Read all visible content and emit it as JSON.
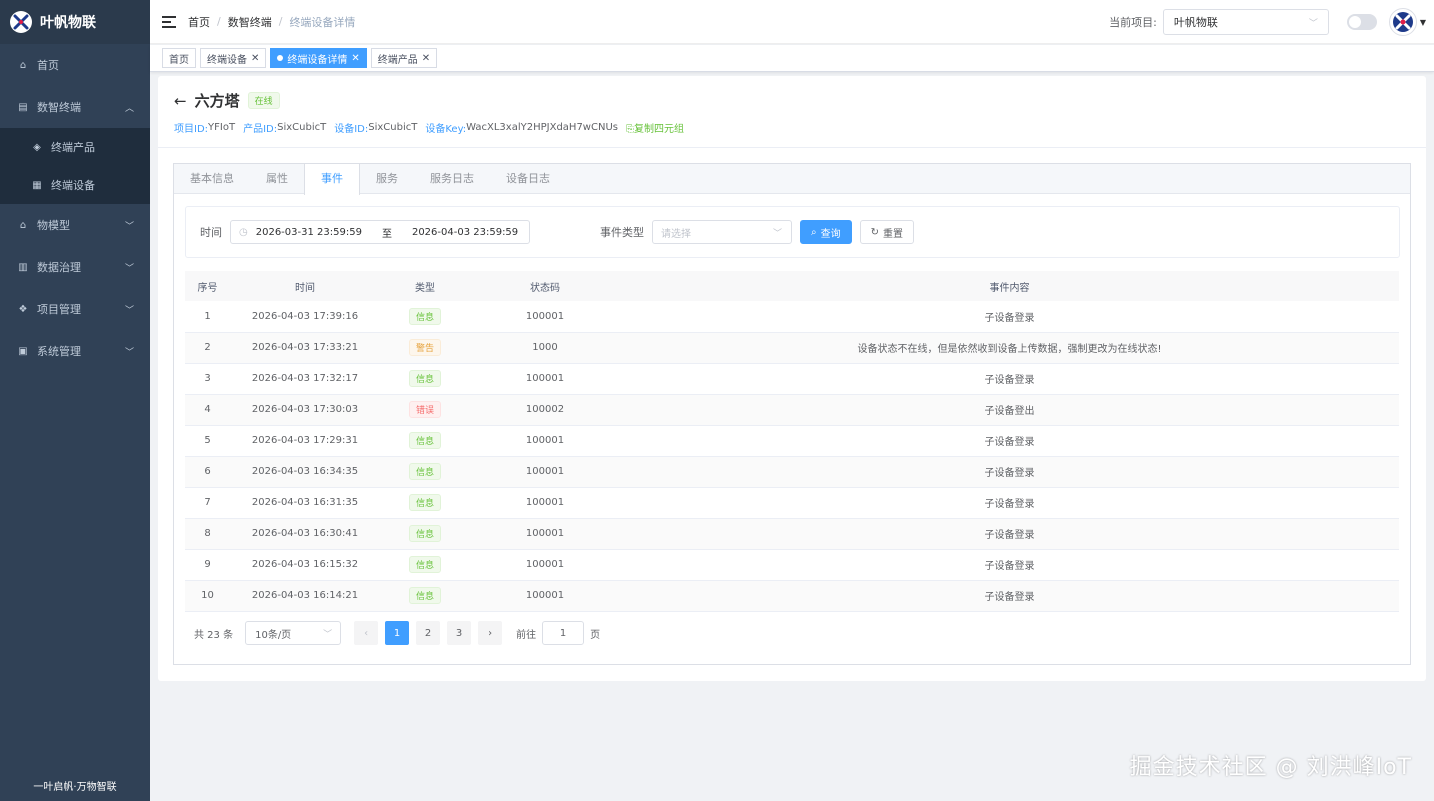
{
  "sidebar": {
    "brand": "叶帆物联",
    "menu": [
      {
        "label": "首页",
        "icon": "home-icon"
      },
      {
        "label": "数智终端",
        "icon": "terminal-icon",
        "expanded": true,
        "children": [
          {
            "label": "终端产品",
            "icon": "cube-icon"
          },
          {
            "label": "终端设备",
            "icon": "device-icon"
          }
        ]
      },
      {
        "label": "物模型",
        "icon": "model-icon"
      },
      {
        "label": "数据治理",
        "icon": "data-icon"
      },
      {
        "label": "项目管理",
        "icon": "project-icon"
      },
      {
        "label": "系统管理",
        "icon": "system-icon"
      }
    ],
    "footer": "一叶启帆·万物智联"
  },
  "navbar": {
    "breadcrumb": [
      "首页",
      "数智终端",
      "终端设备详情"
    ],
    "project_label": "当前项目:",
    "project_value": "叶帆物联"
  },
  "tags": [
    {
      "label": "首页",
      "closable": false,
      "active": false
    },
    {
      "label": "终端设备",
      "closable": true,
      "active": false
    },
    {
      "label": "终端设备详情",
      "closable": true,
      "active": true
    },
    {
      "label": "终端产品",
      "closable": true,
      "active": false
    }
  ],
  "device": {
    "name": "六方塔",
    "status": "在线",
    "project_id_label": "项目ID:",
    "project_id": "YFIoT",
    "product_id_label": "产品ID:",
    "product_id": "SixCubicT",
    "device_id_label": "设备ID:",
    "device_id": "SixCubicT",
    "device_key_label": "设备Key:",
    "device_key": "WacXL3xalY2HPJXdaH7wCNUs",
    "copy_label": "复制四元组"
  },
  "tabs": [
    "基本信息",
    "属性",
    "事件",
    "服务",
    "服务日志",
    "设备日志"
  ],
  "active_tab": 2,
  "filter": {
    "time_label": "时间",
    "start": "2026-03-31 23:59:59",
    "to": "至",
    "end": "2026-04-03 23:59:59",
    "type_label": "事件类型",
    "type_placeholder": "请选择",
    "search_label": "查询",
    "reset_label": "重置"
  },
  "table": {
    "headers": [
      "序号",
      "时间",
      "类型",
      "状态码",
      "事件内容"
    ],
    "rows": [
      {
        "no": "1",
        "time": "2026-04-03 17:39:16",
        "type": "信息",
        "level": "info",
        "code": "100001",
        "content": "子设备登录"
      },
      {
        "no": "2",
        "time": "2026-04-03 17:33:21",
        "type": "警告",
        "level": "warn",
        "code": "1000",
        "content": "设备状态不在线，但是依然收到设备上传数据，强制更改为在线状态!"
      },
      {
        "no": "3",
        "time": "2026-04-03 17:32:17",
        "type": "信息",
        "level": "info",
        "code": "100001",
        "content": "子设备登录"
      },
      {
        "no": "4",
        "time": "2026-04-03 17:30:03",
        "type": "错误",
        "level": "err",
        "code": "100002",
        "content": "子设备登出"
      },
      {
        "no": "5",
        "time": "2026-04-03 17:29:31",
        "type": "信息",
        "level": "info",
        "code": "100001",
        "content": "子设备登录"
      },
      {
        "no": "6",
        "time": "2026-04-03 16:34:35",
        "type": "信息",
        "level": "info",
        "code": "100001",
        "content": "子设备登录"
      },
      {
        "no": "7",
        "time": "2026-04-03 16:31:35",
        "type": "信息",
        "level": "info",
        "code": "100001",
        "content": "子设备登录"
      },
      {
        "no": "8",
        "time": "2026-04-03 16:30:41",
        "type": "信息",
        "level": "info",
        "code": "100001",
        "content": "子设备登录"
      },
      {
        "no": "9",
        "time": "2026-04-03 16:15:32",
        "type": "信息",
        "level": "info",
        "code": "100001",
        "content": "子设备登录"
      },
      {
        "no": "10",
        "time": "2026-04-03 16:14:21",
        "type": "信息",
        "level": "info",
        "code": "100001",
        "content": "子设备登录"
      }
    ]
  },
  "pagination": {
    "total_text": "共 23 条",
    "page_size": "10条/页",
    "pages": [
      "1",
      "2",
      "3"
    ],
    "current": "1",
    "goto_label": "前往",
    "goto_value": "1",
    "page_suffix": "页"
  },
  "watermark": "掘金技术社区 @ 刘洪峰IoT",
  "colors": {
    "primary": "#409eff",
    "sidebar": "#304156",
    "success": "#67c23a",
    "warning": "#e6a23c",
    "danger": "#f56c6c"
  }
}
